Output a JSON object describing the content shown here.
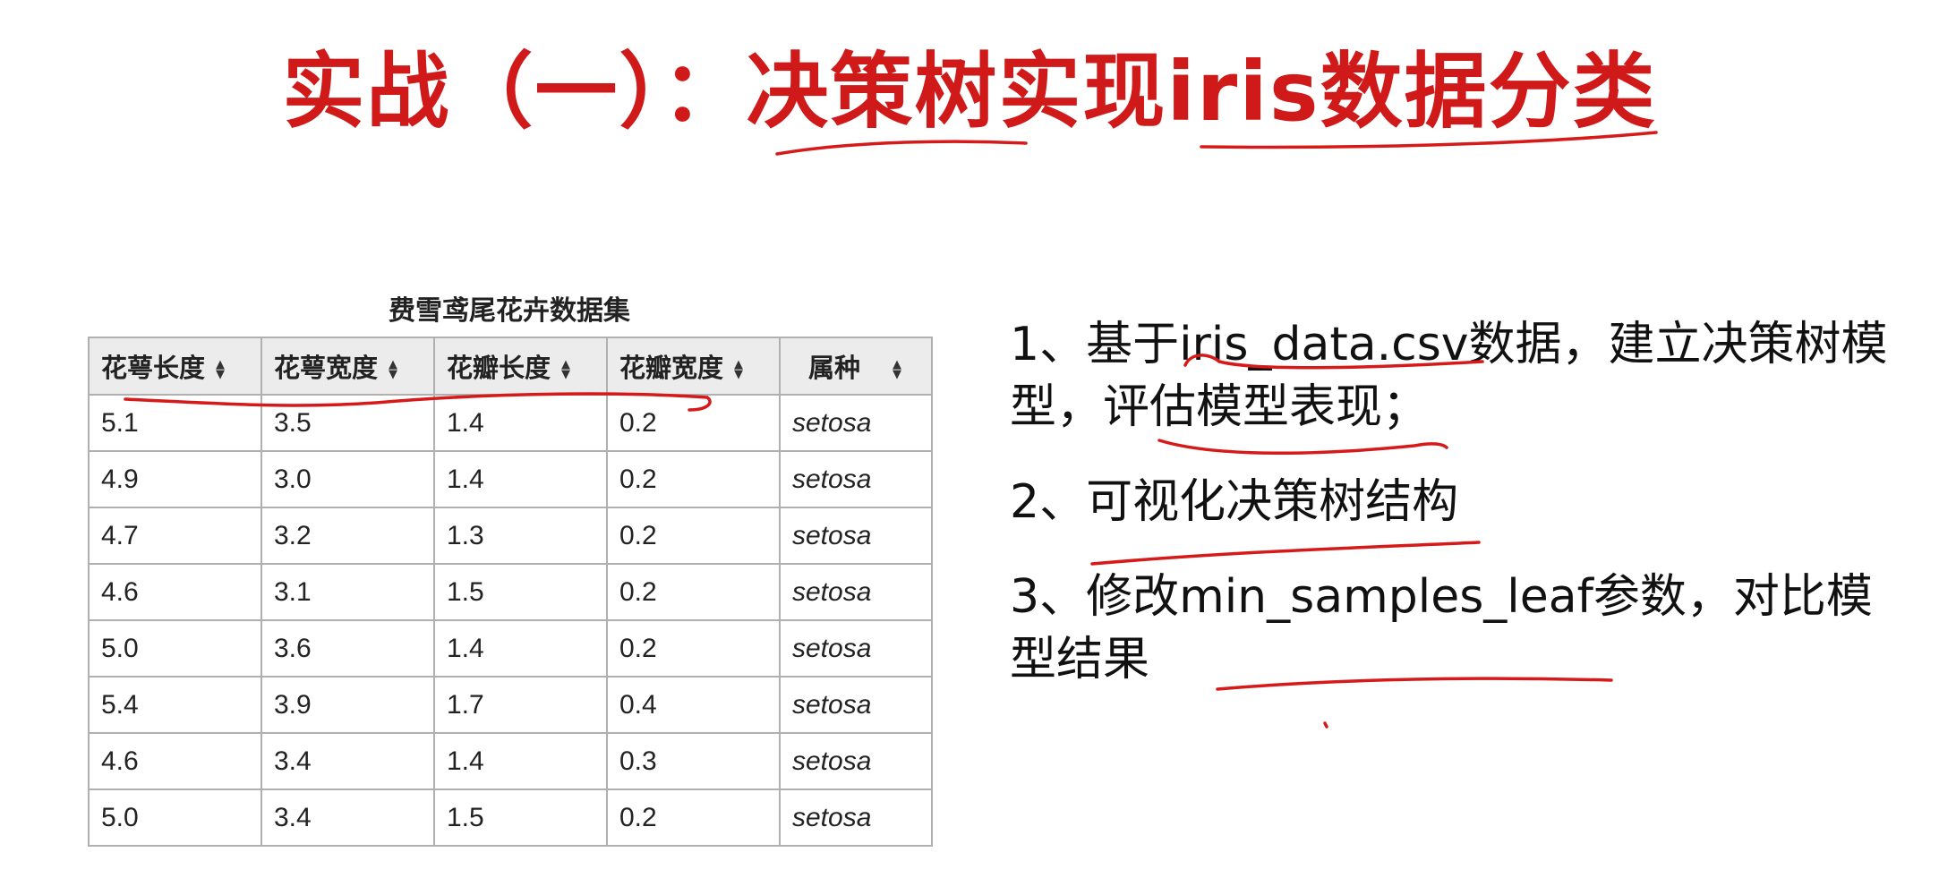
{
  "title": "实战（一）：决策树实现iris数据分类",
  "table": {
    "caption": "费雪鸢尾花卉数据集",
    "headers": [
      "花萼长度",
      "花萼宽度",
      "花瓣长度",
      "花瓣宽度",
      "属种"
    ],
    "rows": [
      [
        "5.1",
        "3.5",
        "1.4",
        "0.2",
        "setosa"
      ],
      [
        "4.9",
        "3.0",
        "1.4",
        "0.2",
        "setosa"
      ],
      [
        "4.7",
        "3.2",
        "1.3",
        "0.2",
        "setosa"
      ],
      [
        "4.6",
        "3.1",
        "1.5",
        "0.2",
        "setosa"
      ],
      [
        "5.0",
        "3.6",
        "1.4",
        "0.2",
        "setosa"
      ],
      [
        "5.4",
        "3.9",
        "1.7",
        "0.4",
        "setosa"
      ],
      [
        "4.6",
        "3.4",
        "1.4",
        "0.3",
        "setosa"
      ],
      [
        "5.0",
        "3.4",
        "1.5",
        "0.2",
        "setosa"
      ]
    ]
  },
  "tasks": [
    "1、基于iris_data.csv数据，建立决策树模型，评估模型表现；",
    "2、可视化决策树结构",
    "3、修改min_samples_leaf参数，对比模型结果"
  ],
  "colors": {
    "title": "#d01a1a",
    "annotation_ink": "#d61a1a",
    "table_border": "#b0b0b0",
    "table_header_bg": "#ececec"
  },
  "icons": {
    "sort": "sort-icon"
  }
}
